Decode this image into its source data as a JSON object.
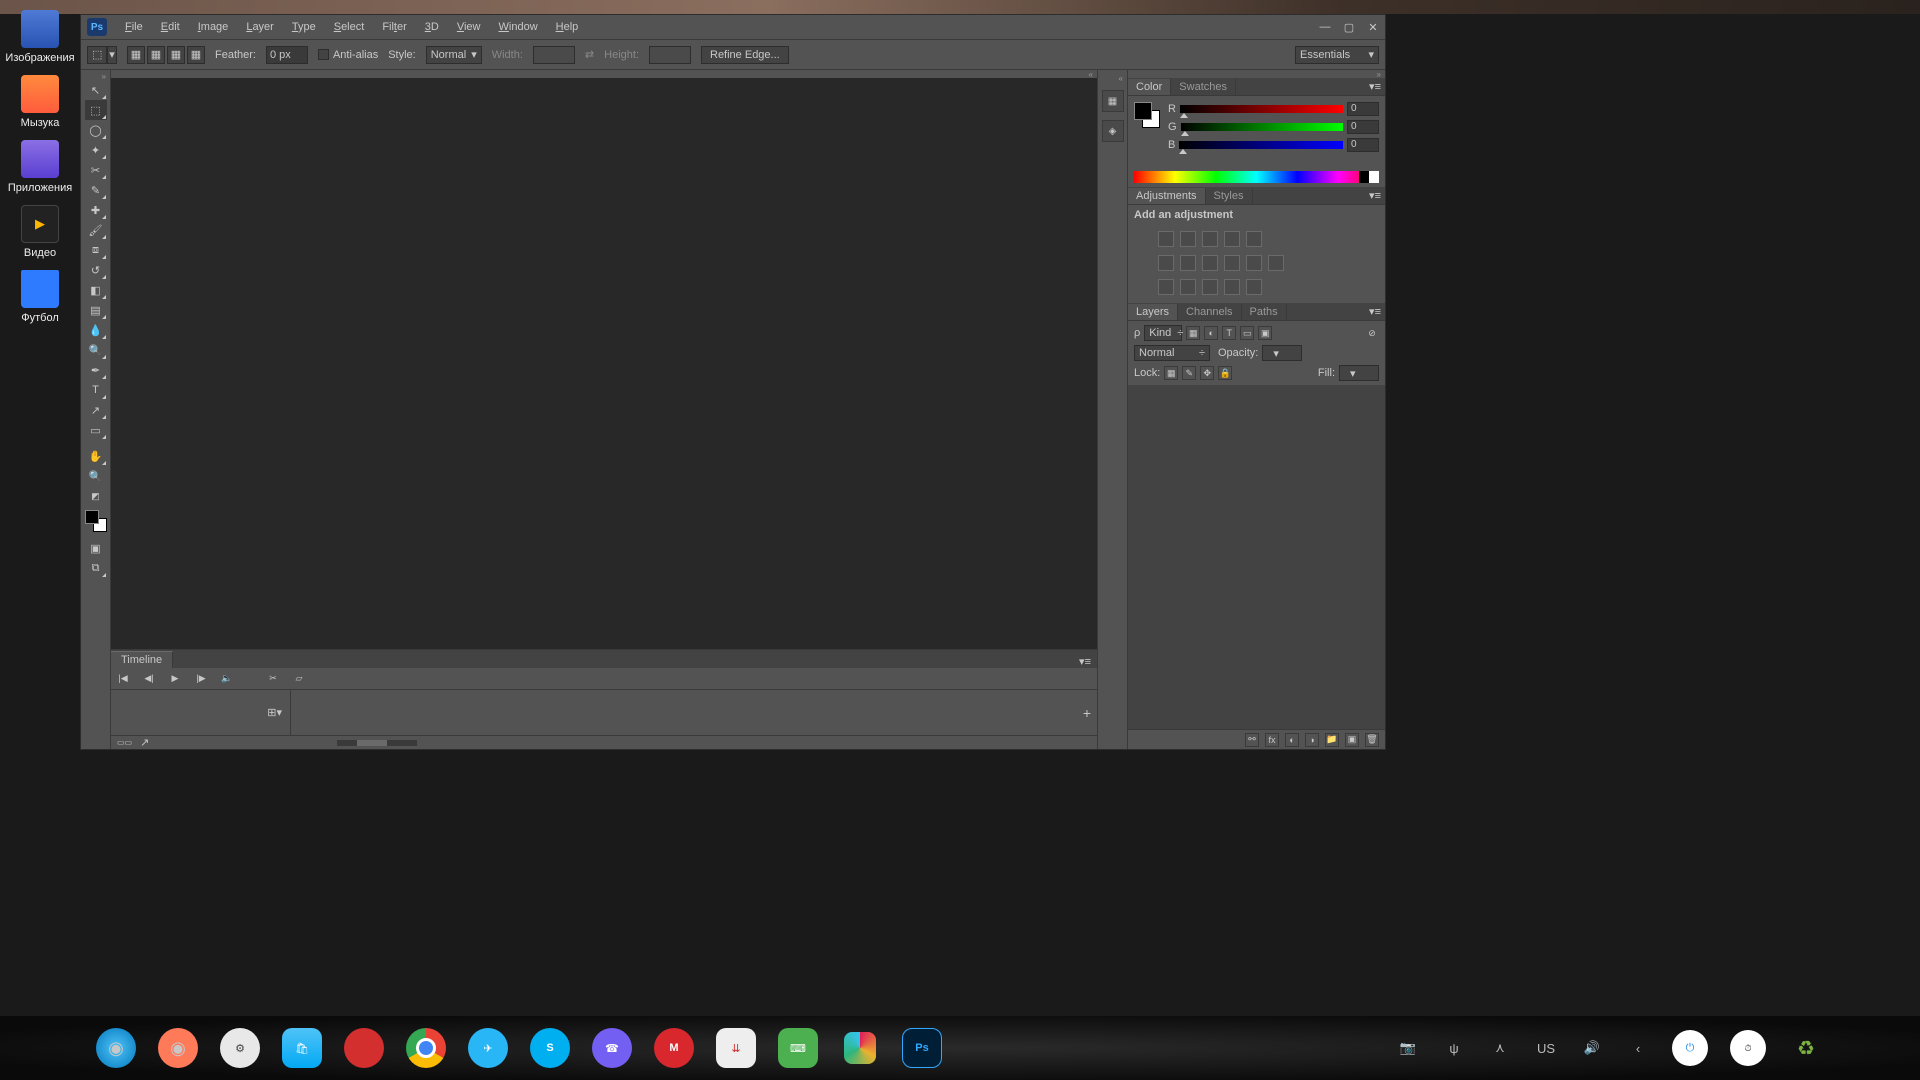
{
  "desktop": {
    "icons": [
      {
        "label": "Изображения"
      },
      {
        "label": "Мызука"
      },
      {
        "label": "Приложения"
      },
      {
        "label": "Видео"
      },
      {
        "label": "Футбол"
      }
    ]
  },
  "window": {
    "logo_text": "Ps",
    "menu": [
      {
        "label": "File",
        "u": "F"
      },
      {
        "label": "Edit",
        "u": "E"
      },
      {
        "label": "Image",
        "u": "I"
      },
      {
        "label": "Layer",
        "u": "L"
      },
      {
        "label": "Type",
        "u": "T"
      },
      {
        "label": "Select",
        "u": "S"
      },
      {
        "label": "Filter",
        "u": "t"
      },
      {
        "label": "3D",
        "u": "3"
      },
      {
        "label": "View",
        "u": "V"
      },
      {
        "label": "Window",
        "u": "W"
      },
      {
        "label": "Help",
        "u": "H"
      }
    ]
  },
  "options": {
    "feather_label": "Feather:",
    "feather_value": "0 px",
    "antialias_label": "Anti-alias",
    "style_label": "Style:",
    "style_value": "Normal",
    "width_label": "Width:",
    "height_label": "Height:",
    "swap_symbol": "⇄",
    "refine_label": "Refine Edge...",
    "workspace": "Essentials"
  },
  "timeline": {
    "tab": "Timeline"
  },
  "panels": {
    "color_tab": "Color",
    "swatches_tab": "Swatches",
    "r": "R",
    "g": "G",
    "b": "B",
    "r_val": "0",
    "g_val": "0",
    "b_val": "0",
    "adjustments_tab": "Adjustments",
    "styles_tab": "Styles",
    "adjustments_title": "Add an adjustment",
    "layers_tab": "Layers",
    "channels_tab": "Channels",
    "paths_tab": "Paths",
    "kind_label": "Kind",
    "blend_mode": "Normal",
    "opacity_label": "Opacity:",
    "lock_label": "Lock:",
    "fill_label": "Fill:"
  },
  "tray": {
    "lang": "US"
  }
}
